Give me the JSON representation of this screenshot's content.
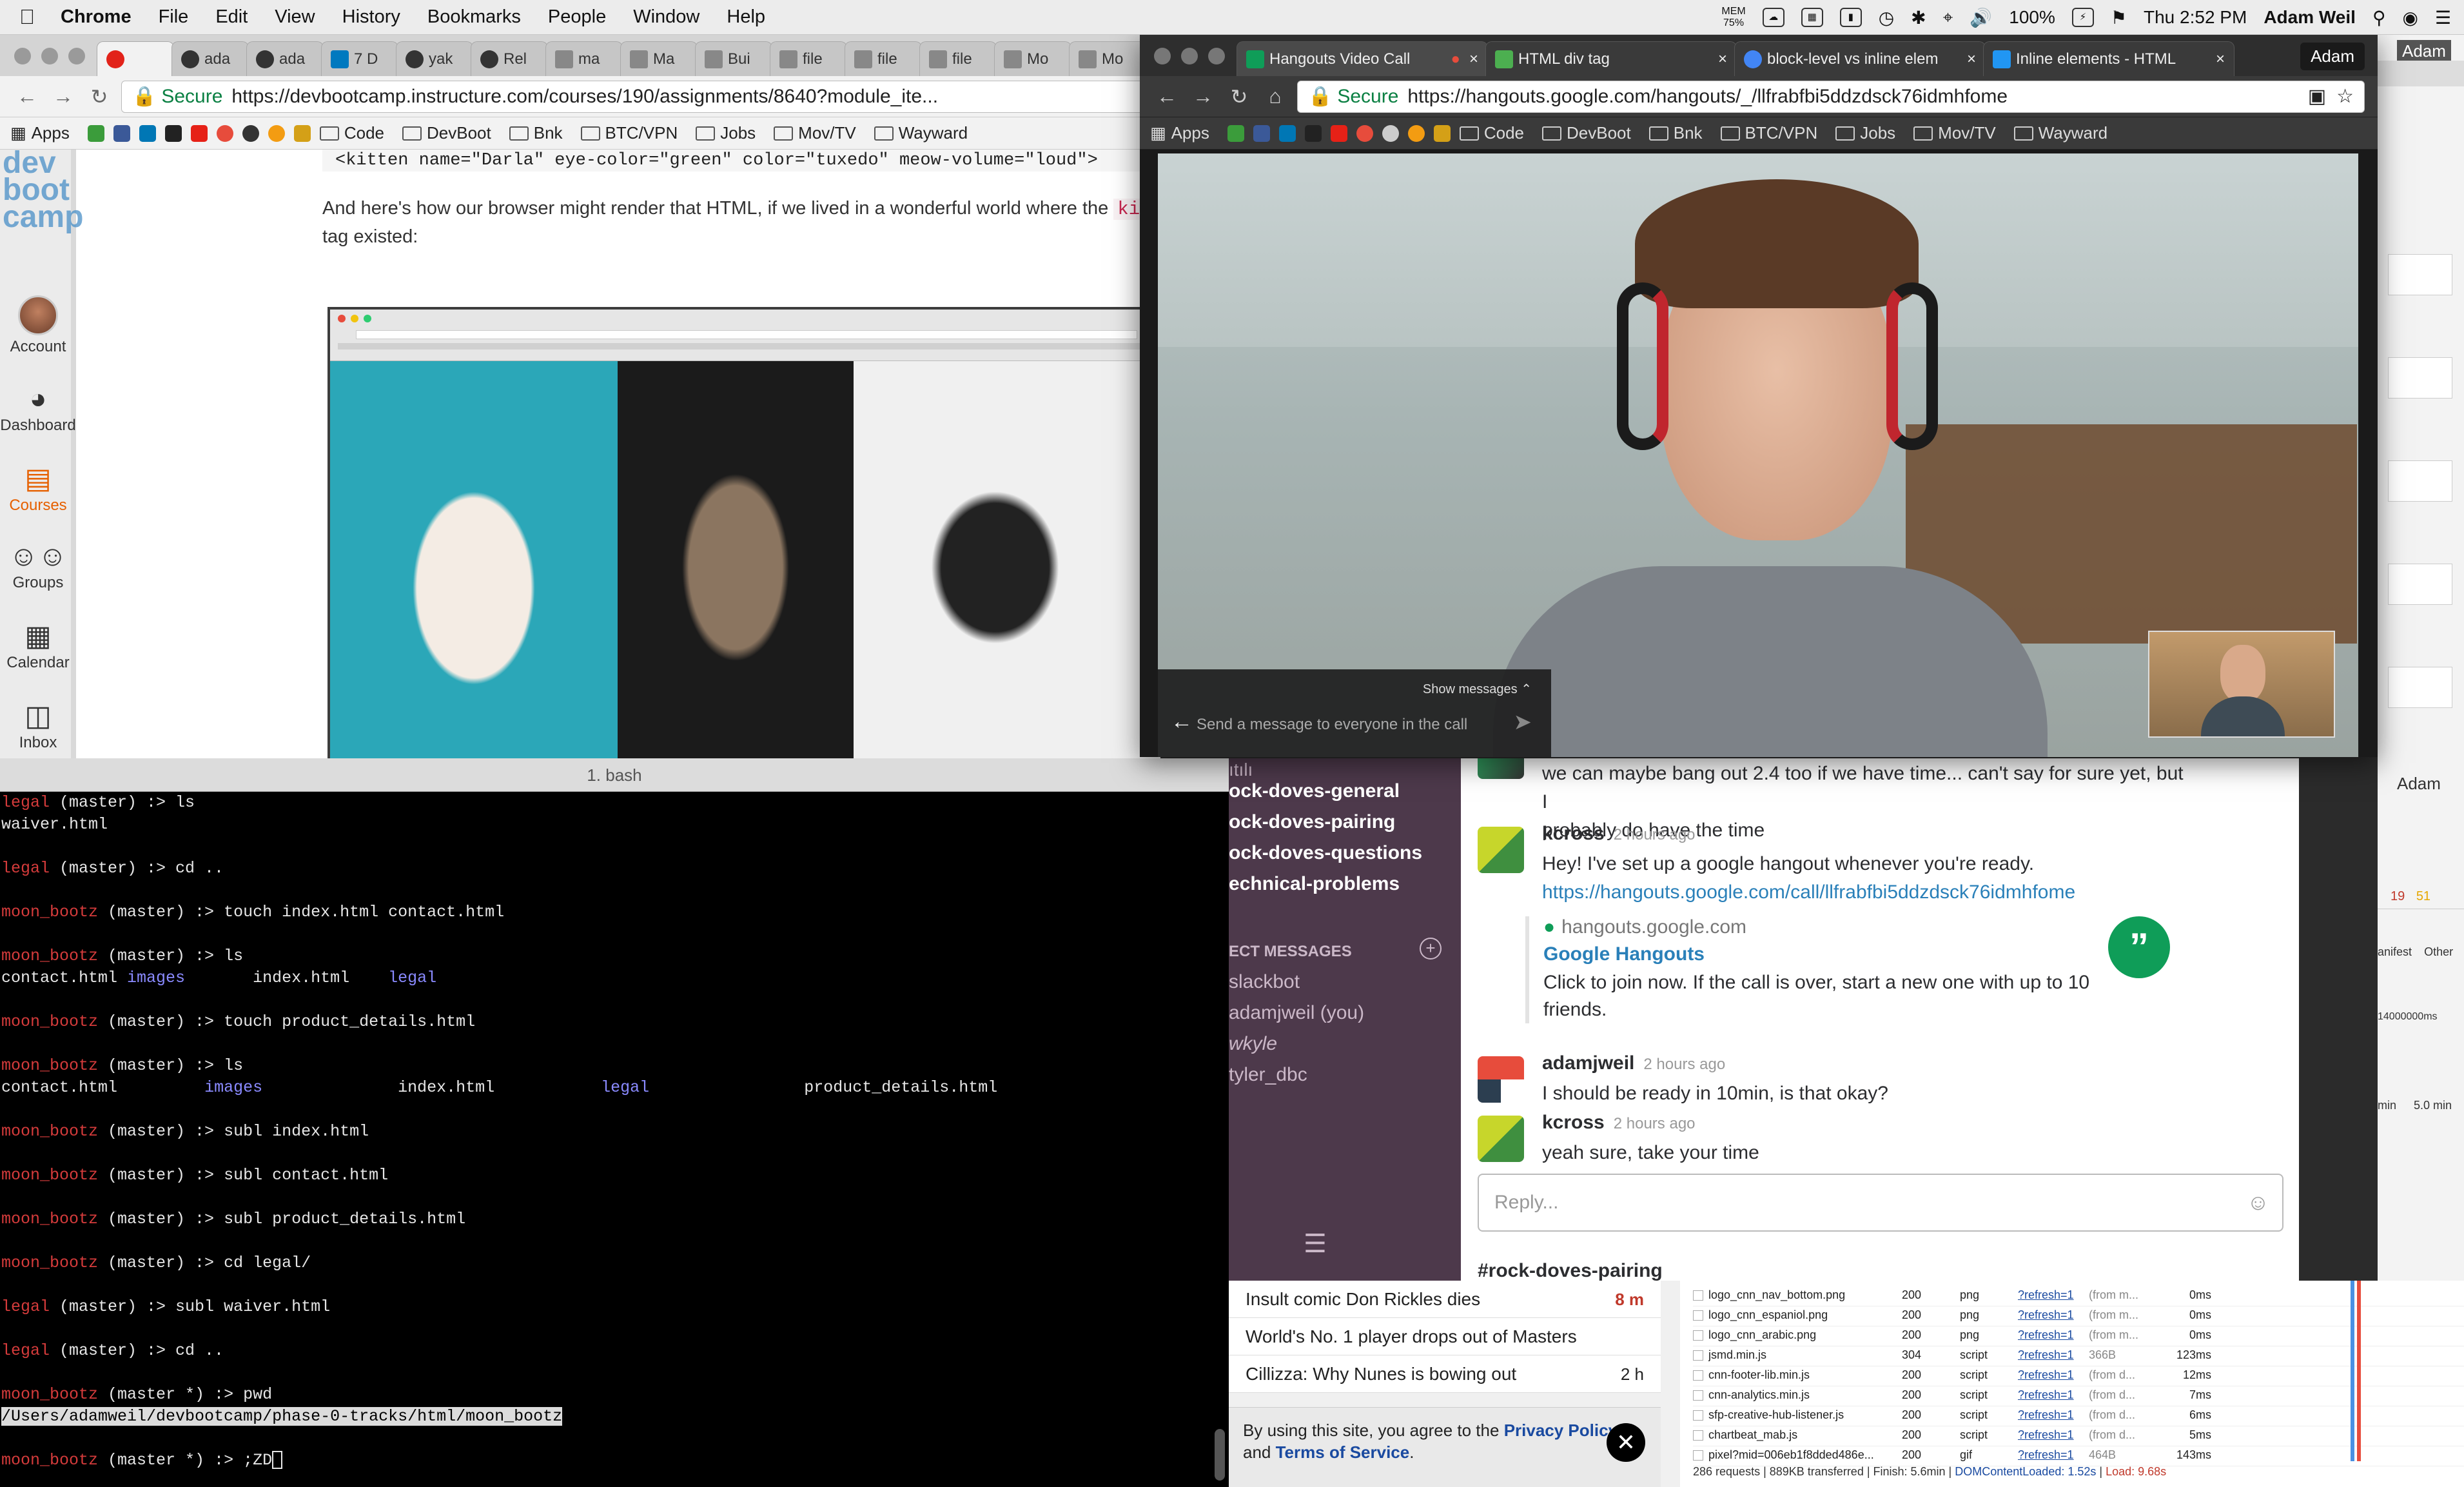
{
  "menubar": {
    "items": [
      "Chrome",
      "File",
      "Edit",
      "View",
      "History",
      "Bookmarks",
      "People",
      "Window",
      "Help"
    ],
    "mem_label": "MEM",
    "mem_value": "75%",
    "battery": "100%",
    "clock": "Thu 2:52 PM",
    "user": "Adam Weil"
  },
  "win1": {
    "tabs": [
      "",
      "ada",
      "ada",
      "7 D",
      "yak",
      "Rel",
      "ma",
      "Ma",
      "Bui",
      "file",
      "file",
      "file",
      "Mo",
      "Mo"
    ],
    "secure": "Secure",
    "url": "https://devbootcamp.instructure.com/courses/190/assignments/8640?module_ite...",
    "bookmarks": [
      "Apps",
      "Code",
      "DevBoot",
      "Bnk",
      "BTC/VPN",
      "Jobs",
      "Mov/TV",
      "Wayward"
    ],
    "nav": {
      "logo": [
        "dev",
        "boot",
        "camp"
      ],
      "items": [
        "Account",
        "Dashboard",
        "Courses",
        "Groups",
        "Calendar",
        "Inbox"
      ]
    },
    "content": {
      "code_line": "<kitten name=\"Darla\" eye-color=\"green\" color=\"tuxedo\" meow-volume=\"loud\">",
      "para_before": "And here's how our browser might render that HTML, if we lived in a wonderful world where the ",
      "para_code": "kit",
      "para_after": "tag existed:"
    }
  },
  "win2": {
    "tabs": [
      "Hangouts Video Call",
      "HTML div tag",
      "block-level vs inline elem",
      "Inline elements - HTML"
    ],
    "profile": "Adam",
    "secure": "Secure",
    "url": "https://hangouts.google.com/hangouts/_/llfrabfbi5ddzdsck76idmhfome",
    "bookmarks": [
      "Apps",
      "Code",
      "DevBoot",
      "Bnk",
      "BTC/VPN",
      "Jobs",
      "Mov/TV",
      "Wayward"
    ],
    "call": {
      "show_messages": "Show messages",
      "input_placeholder": "Send a message to everyone in the call"
    }
  },
  "terminal": {
    "title": "1. bash",
    "lines": [
      {
        "prompt": "legal",
        "rest": " (master) :> ls"
      },
      {
        "out": "waiver.html"
      },
      {
        "gap": true
      },
      {
        "prompt": "legal",
        "rest": " (master) :> cd .."
      },
      {
        "gap": true
      },
      {
        "prompt": "moon_bootz",
        "rest": " (master) :> touch index.html contact.html"
      },
      {
        "gap": true
      },
      {
        "prompt": "moon_bootz",
        "rest": " (master) :> ls"
      },
      {
        "out": "contact.html ",
        "blue1": "images",
        "out2": "       index.html    ",
        "blue2": "legal"
      },
      {
        "gap": true
      },
      {
        "prompt": "moon_bootz",
        "rest": " (master) :> touch product_details.html"
      },
      {
        "gap": true
      },
      {
        "prompt": "moon_bootz",
        "rest": " (master) :> ls"
      },
      {
        "out": "contact.html         ",
        "blue1": "images",
        "out2": "              index.html           ",
        "blue2": "legal",
        "out3": "                product_details.html"
      },
      {
        "gap": true
      },
      {
        "prompt": "moon_bootz",
        "rest": " (master) :> subl index.html"
      },
      {
        "gap": true
      },
      {
        "prompt": "moon_bootz",
        "rest": " (master) :> subl contact.html"
      },
      {
        "gap": true
      },
      {
        "prompt": "moon_bootz",
        "rest": " (master) :> subl product_details.html"
      },
      {
        "gap": true
      },
      {
        "prompt": "moon_bootz",
        "rest": " (master) :> cd legal/"
      },
      {
        "gap": true
      },
      {
        "prompt": "legal",
        "rest": " (master) :> subl waiver.html"
      },
      {
        "gap": true
      },
      {
        "prompt": "legal",
        "rest": " (master) :> cd .."
      },
      {
        "gap": true
      },
      {
        "prompt": "moon_bootz",
        "rest": " (master *) :> pwd"
      },
      {
        "sel": "/Users/adamweil/devbootcamp/phase-0-tracks/html/moon_bootz"
      },
      {
        "gap": true
      },
      {
        "prompt": "moon_bootz",
        "rest": " (master *) :> ;ZD",
        "cursor": true
      }
    ]
  },
  "slack": {
    "channels": [
      "ock-doves-general",
      "ock-doves-pairing",
      "ock-doves-questions",
      "echnical-problems"
    ],
    "dm_header": "ECT MESSAGES",
    "dms": [
      "slackbot",
      "adamjweil (you)",
      "wkyle",
      "tyler_dbc"
    ],
    "partial_top": "we can maybe bang out 2.4 too if we have time... can't say for sure yet, but I",
    "partial_top2": "probably do have the time",
    "messages": [
      {
        "user": "kcross",
        "time": "2 hours ago",
        "text": "Hey! I've set up a google hangout whenever you're ready.",
        "link": "https://hangouts.google.com/call/llfrabfbi5ddzdsck76idmhfome"
      },
      {
        "user": "adamjweil",
        "time": "2 hours ago",
        "text": "I should be ready in 10min, is that okay?"
      },
      {
        "user": "kcross",
        "time": "2 hours ago",
        "text": "yeah sure, take your time"
      }
    ],
    "unfurl": {
      "domain": "hangouts.google.com",
      "title": "Google Hangouts",
      "desc": "Click to join now. If the call is over, start a new one with up to 10 friends."
    },
    "reply_placeholder": "Reply...",
    "below_channel": "#rock-doves-pairing"
  },
  "news": {
    "rows": [
      {
        "title": "Insult comic Don Rickles dies",
        "time": "8 m",
        "hot": true
      },
      {
        "title": "World's No. 1 player drops out of Masters",
        "time": ""
      },
      {
        "title": "Cillizza: Why Nunes is bowing out",
        "time": "2 h"
      }
    ],
    "cookie_text": "By using this site, you agree to the ",
    "privacy": "Privacy Policy",
    "and": " and ",
    "terms": "Terms of Service",
    "period": "."
  },
  "devtools": {
    "rows": [
      [
        "logo_cnn_nav_bottom.png",
        "200",
        "png",
        "?refresh=1",
        "(from m...",
        "0ms"
      ],
      [
        "logo_cnn_espaniol.png",
        "200",
        "png",
        "?refresh=1",
        "(from m...",
        "0ms"
      ],
      [
        "logo_cnn_arabic.png",
        "200",
        "png",
        "?refresh=1",
        "(from m...",
        "0ms"
      ],
      [
        "jsmd.min.js",
        "304",
        "script",
        "?refresh=1",
        "366B",
        "123ms"
      ],
      [
        "cnn-footer-lib.min.js",
        "200",
        "script",
        "?refresh=1",
        "(from d...",
        "12ms"
      ],
      [
        "cnn-analytics.min.js",
        "200",
        "script",
        "?refresh=1",
        "(from d...",
        "7ms"
      ],
      [
        "sfp-creative-hub-listener.js",
        "200",
        "script",
        "?refresh=1",
        "(from d...",
        "6ms"
      ],
      [
        "chartbeat_mab.js",
        "200",
        "script",
        "?refresh=1",
        "(from d...",
        "5ms"
      ],
      [
        "pixel?mid=006eb1f8dded486e...",
        "200",
        "gif",
        "?refresh=1",
        "464B",
        "143ms"
      ]
    ],
    "status": "286 requests | 889KB transferred | Finish: 5.6min | ",
    "dcl": "DOMContentLoaded: 1.52s",
    "sep": " | ",
    "load": "Load: 9.68s"
  },
  "right_col": {
    "profile": "Adam",
    "errors": "19",
    "warnings": "51",
    "manifest": "anifest",
    "other": "Other",
    "size": "14000000ms",
    "min": "min",
    "five_min": "5.0 min"
  }
}
